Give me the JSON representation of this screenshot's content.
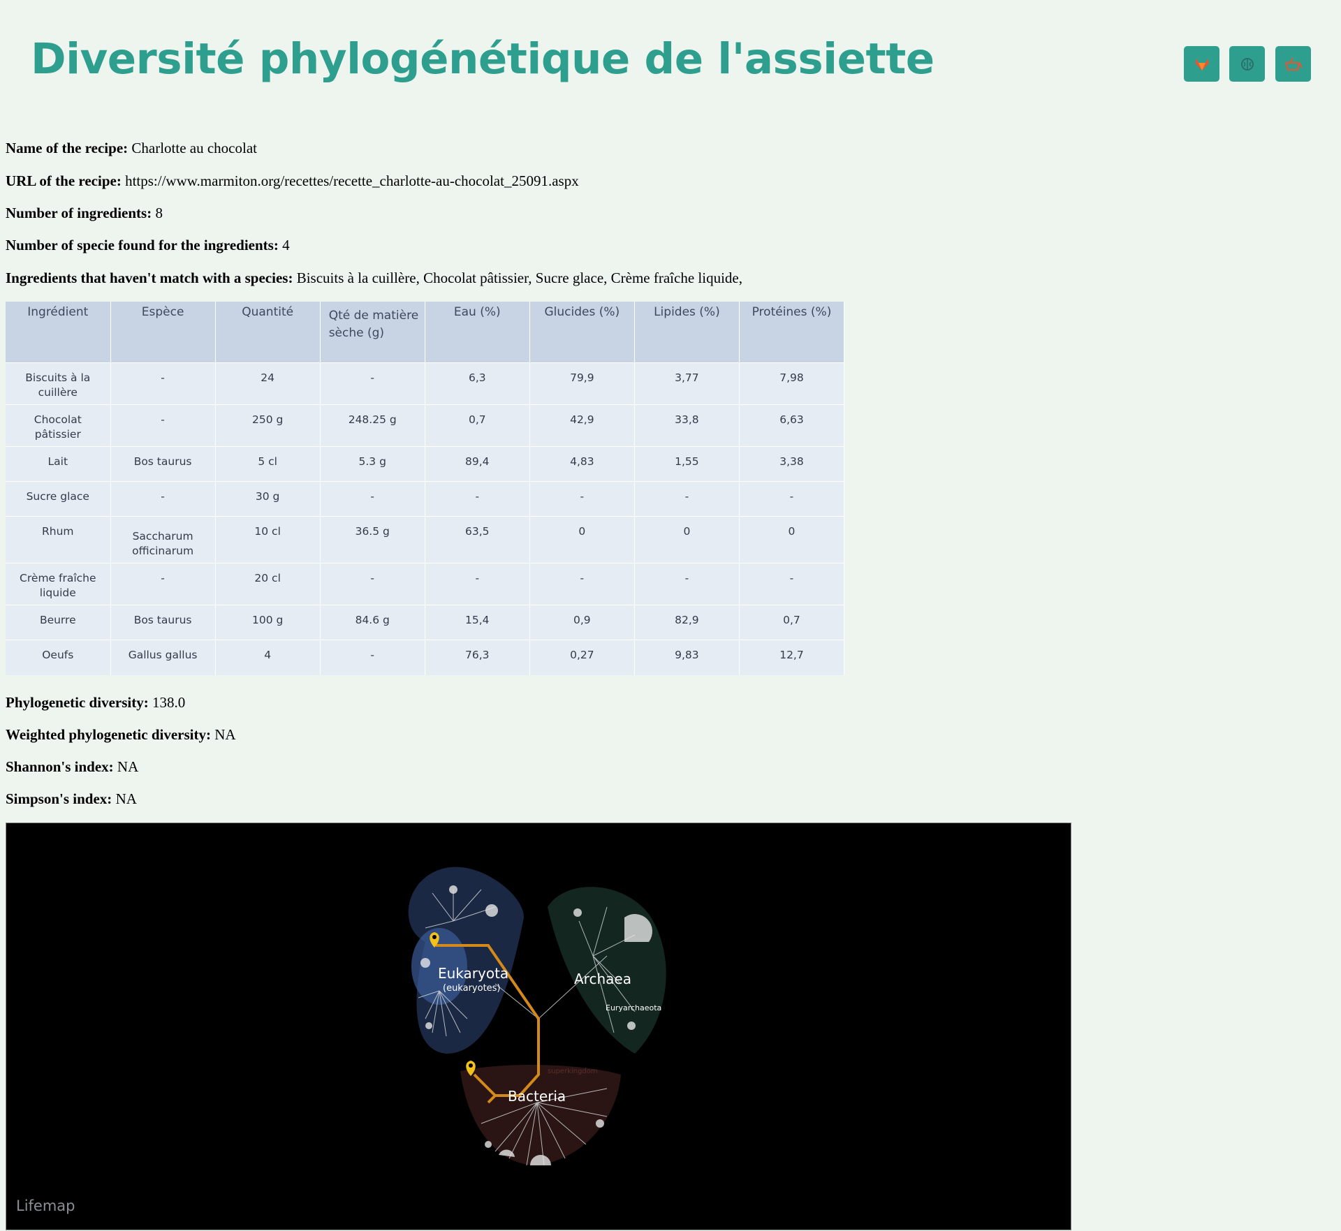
{
  "header": {
    "title": "Diversité phylogénétique de l'assiette",
    "buttons": [
      {
        "icon": "gitlab-icon",
        "color": "#e8552f"
      },
      {
        "icon": "brain-icon",
        "color": "#2b6f68"
      },
      {
        "icon": "shopping-basket-icon",
        "color": "#e8552f"
      }
    ]
  },
  "recipe": {
    "name_label": "Name of the recipe:",
    "name": "Charlotte au chocolat",
    "url_label": "URL of the recipe:",
    "url": "https://www.marmiton.org/recettes/recette_charlotte-au-chocolat_25091.aspx",
    "n_ingredients_label": "Number of ingredients:",
    "n_ingredients": "8",
    "n_species_label": "Number of specie found for the ingredients:",
    "n_species": "4",
    "unmatched_label": "Ingredients that haven't match with a species:",
    "unmatched": "Biscuits à la cuillère, Chocolat pâtissier, Sucre glace, Crème fraîche liquide,"
  },
  "table": {
    "headers": [
      "Ingrédient",
      "Espèce",
      "Quantité",
      "Qté de matière  sèche (g)",
      "Eau (%)",
      "Glucides (%)",
      "Lipides (%)",
      "Protéines (%)"
    ],
    "rows": [
      [
        "Biscuits à la cuillère",
        "-",
        "24",
        "-",
        "6,3",
        "79,9",
        "3,77",
        "7,98"
      ],
      [
        "Chocolat pâtissier",
        "-",
        "250 g",
        "248.25 g",
        "0,7",
        "42,9",
        "33,8",
        "6,63"
      ],
      [
        "Lait",
        "Bos taurus",
        "5 cl",
        "5.3 g",
        "89,4",
        "4,83",
        "1,55",
        "3,38"
      ],
      [
        "Sucre glace",
        "-",
        "30 g",
        "-",
        "-",
        "-",
        "-",
        "-"
      ],
      [
        "Rhum",
        "Saccharum officinarum",
        "10 cl",
        "36.5 g",
        "63,5",
        "0",
        "0",
        "0"
      ],
      [
        "Crème fraîche liquide",
        "-",
        "20 cl",
        "-",
        "-",
        "-",
        "-",
        "-"
      ],
      [
        "Beurre",
        "Bos taurus",
        "100 g",
        "84.6 g",
        "15,4",
        "0,9",
        "82,9",
        "0,7"
      ],
      [
        "Oeufs",
        "Gallus gallus",
        "4",
        "-",
        "76,3",
        "0,27",
        "9,83",
        "12,7"
      ]
    ]
  },
  "indices": {
    "pd_label": "Phylogenetic diversity:",
    "pd": "138.0",
    "wpd_label": "Weighted phylogenetic diversity:",
    "wpd": "NA",
    "shannon_label": "Shannon's index:",
    "shannon": "NA",
    "simpson_label": "Simpson's index:",
    "simpson": "NA"
  },
  "map": {
    "watermark": "Lifemap",
    "labels": {
      "eukaryota": "Eukaryota",
      "eukaryotes": "(eukaryotes)",
      "archaea": "Archaea",
      "euryarchaeota": "Euryarchaeota",
      "bacteria": "Bacteria",
      "superkingdom": "superkingdom"
    },
    "colors": {
      "path": "#d48a1a",
      "marker": "#f2c21b",
      "eukaryota_bg": "#1c2a48",
      "archaea_bg": "#132620",
      "bacteria_bg": "#2a1514"
    }
  }
}
